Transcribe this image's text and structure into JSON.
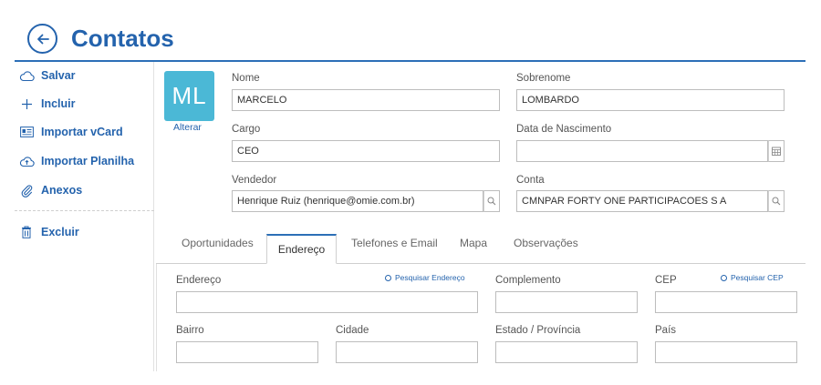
{
  "header": {
    "title": "Contatos"
  },
  "sidebar": {
    "items": [
      {
        "label": "Salvar",
        "icon": "cloud-icon"
      },
      {
        "label": "Incluir",
        "icon": "plus-icon"
      },
      {
        "label": "Importar vCard",
        "icon": "vcard-icon"
      },
      {
        "label": "Importar Planilha",
        "icon": "cloud-upload-icon"
      },
      {
        "label": "Anexos",
        "icon": "paperclip-icon"
      },
      {
        "label": "Excluir",
        "icon": "trash-icon"
      }
    ]
  },
  "avatar": {
    "initials": "ML",
    "change_label": "Alterar",
    "color": "#4bb8d6"
  },
  "form": {
    "nome": {
      "label": "Nome",
      "value": "MARCELO"
    },
    "sobrenome": {
      "label": "Sobrenome",
      "value": "LOMBARDO"
    },
    "cargo": {
      "label": "Cargo",
      "value": "CEO"
    },
    "nascimento": {
      "label": "Data de Nascimento",
      "value": ""
    },
    "vendedor": {
      "label": "Vendedor",
      "value": "Henrique Ruiz (henrique@omie.com.br)"
    },
    "conta": {
      "label": "Conta",
      "value": "CMNPAR FORTY ONE PARTICIPACOES S A"
    }
  },
  "tabs": [
    "Oportunidades",
    "Endereço",
    "Telefones e Email",
    "Mapa",
    "Observações"
  ],
  "active_tab": "Endereço",
  "address": {
    "endereco": {
      "label": "Endereço",
      "value": ""
    },
    "pesquisar_endereco": "Pesquisar Endereço",
    "complemento": {
      "label": "Complemento",
      "value": ""
    },
    "cep": {
      "label": "CEP",
      "value": ""
    },
    "pesquisar_cep": "Pesquisar CEP",
    "bairro": {
      "label": "Bairro",
      "value": ""
    },
    "cidade": {
      "label": "Cidade",
      "value": ""
    },
    "estado": {
      "label": "Estado / Província",
      "value": ""
    },
    "pais": {
      "label": "País",
      "value": ""
    }
  },
  "colors": {
    "accent": "#2463ad",
    "accent_line": "#2c6fb7"
  }
}
